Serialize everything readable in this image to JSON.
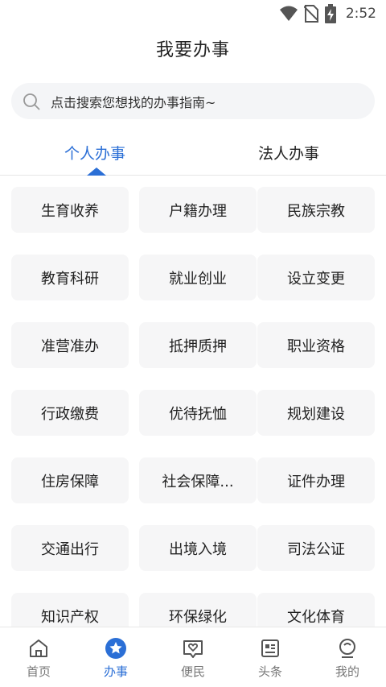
{
  "status_bar": {
    "time": "2:52"
  },
  "header": {
    "title": "我要办事"
  },
  "search": {
    "placeholder": "点击搜索您想找的办事指南~"
  },
  "tabs": [
    {
      "label": "个人办事",
      "active": true
    },
    {
      "label": "法人办事",
      "active": false
    }
  ],
  "grid": {
    "items": [
      "生育收养",
      "户籍办理",
      "民族宗教",
      "教育科研",
      "就业创业",
      "设立变更",
      "准营准办",
      "抵押质押",
      "职业资格",
      "行政缴费",
      "优待抚恤",
      "规划建设",
      "住房保障",
      "社会保障...",
      "证件办理",
      "交通出行",
      "出境入境",
      "司法公证",
      "知识产权",
      "环保绿化",
      "文化体育"
    ]
  },
  "bottom_nav": {
    "items": [
      {
        "label": "首页",
        "icon": "home-icon",
        "active": false
      },
      {
        "label": "办事",
        "icon": "star-icon",
        "active": true
      },
      {
        "label": "便民",
        "icon": "heart-icon",
        "active": false
      },
      {
        "label": "头条",
        "icon": "news-icon",
        "active": false
      },
      {
        "label": "我的",
        "icon": "profile-icon",
        "active": false
      }
    ]
  },
  "colors": {
    "accent": "#2b6fd6",
    "cell_bg": "#f6f6f7",
    "search_bg": "#f4f5f7"
  }
}
